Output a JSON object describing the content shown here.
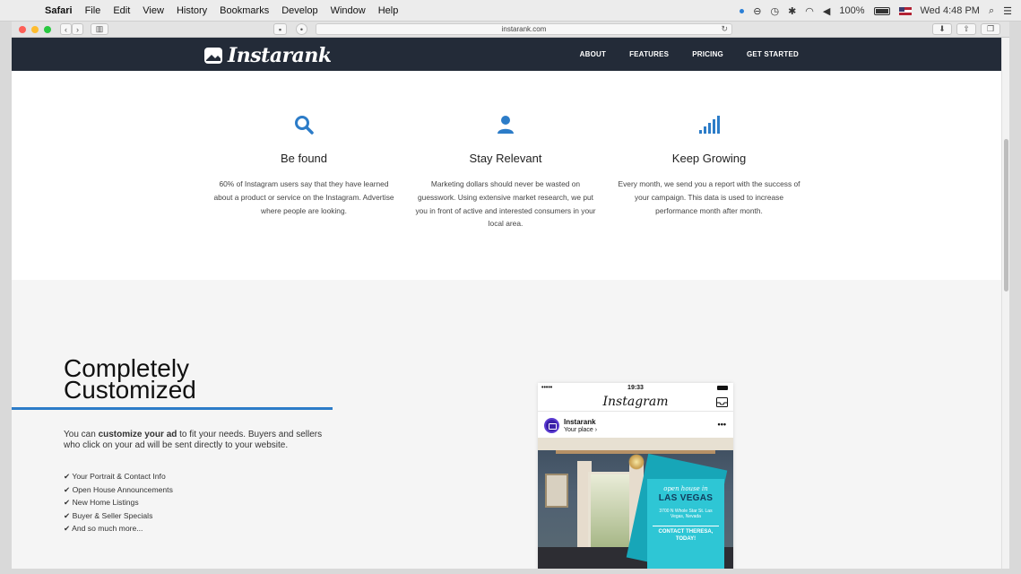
{
  "menubar": {
    "items": [
      "Safari",
      "File",
      "Edit",
      "View",
      "History",
      "Bookmarks",
      "Develop",
      "Window",
      "Help"
    ],
    "battery": "100%",
    "clock": "Wed 4:48 PM"
  },
  "browser": {
    "url": "instarank.com"
  },
  "site": {
    "logo_text": "Instarank",
    "nav": [
      "ABOUT",
      "FEATURES",
      "PRICING",
      "GET STARTED"
    ],
    "accent": "#2c7cc8",
    "nav_bg": "#232b38"
  },
  "features": [
    {
      "icon": "search-icon",
      "title": "Be found",
      "text": "60% of Instagram users say that they have learned about a product or service on the Instagram. Advertise where people are looking."
    },
    {
      "icon": "user-icon",
      "title": "Stay Relevant",
      "text": "Marketing dollars should never be wasted on guesswork. Using extensive market research, we put you in front of active and interested consumers in your local area."
    },
    {
      "icon": "signal-bars-icon",
      "title": "Keep Growing",
      "text": "Every month, we send you a report with the success of your campaign. This data is used to increase performance month after month."
    }
  ],
  "custom": {
    "title_line1": "Completely",
    "title_line2": "Customized",
    "desc_pre": "You can ",
    "desc_bold": "customize your ad",
    "desc_post": " to fit your needs. Buyers and sellers who click on your ad will be sent directly to your website.",
    "list": [
      "✔ Your Portrait & Contact Info",
      "✔ Open House Announcements",
      "✔ New Home Listings",
      "✔ Buyer  & Seller Specials",
      "✔ And so much more..."
    ]
  },
  "phone": {
    "signal": "•••••",
    "time": "19:33",
    "app_name": "Instagram",
    "account": "Instarank",
    "location": "Your place ›",
    "more": "•••",
    "card_tagline": "open house in",
    "card_city": "LAS VEGAS",
    "card_address": "3700 N Whole Star St. Las Vegas, Nevada",
    "card_contact": "CONTACT THERESA, TODAY!"
  }
}
